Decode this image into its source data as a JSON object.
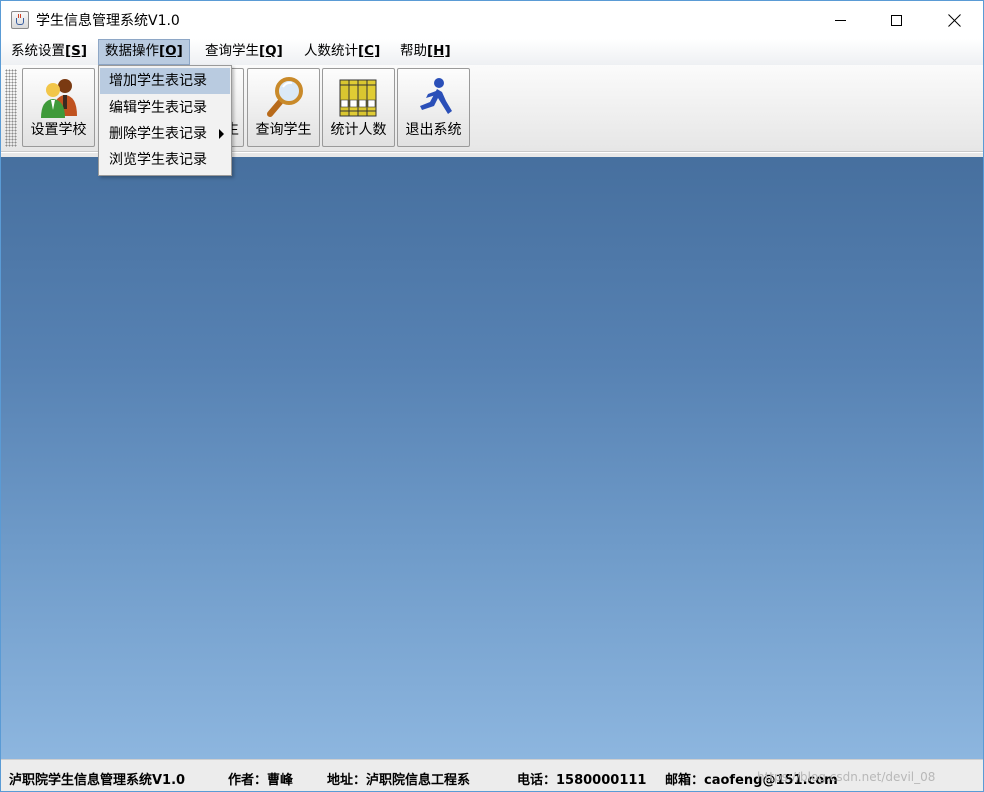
{
  "window": {
    "title": "学生信息管理系统V1.0"
  },
  "menubar": {
    "items": [
      {
        "label": "系统设置",
        "mnemonic": "[S]"
      },
      {
        "label": "数据操作",
        "mnemonic": "[O]"
      },
      {
        "label": "查询学生",
        "mnemonic": "[Q]"
      },
      {
        "label": "人数统计",
        "mnemonic": "[C]"
      },
      {
        "label": "帮助",
        "mnemonic": "[H]"
      }
    ]
  },
  "toolbar": {
    "buttons": [
      {
        "label": "设置学校",
        "icon": "users-icon"
      },
      {
        "label": "生",
        "icon": "hidden-icon"
      },
      {
        "label": "查询学生",
        "icon": "magnifier-icon"
      },
      {
        "label": "统计人数",
        "icon": "binders-icon"
      },
      {
        "label": "退出系统",
        "icon": "running-man-icon"
      }
    ]
  },
  "dropdown": {
    "items": [
      {
        "label": "增加学生表记录"
      },
      {
        "label": "编辑学生表记录"
      },
      {
        "label": "删除学生表记录"
      },
      {
        "label": "浏览学生表记录"
      }
    ]
  },
  "statusbar": {
    "app": "泸职院学生信息管理系统V1.0",
    "author": "作者：曹峰",
    "address": "地址：泸职院信息工程系",
    "phone": "电话：1580000111",
    "email": "邮箱：caofeng@151.com",
    "watermark": "https://blog.csdn.net/devil_08"
  },
  "colors": {
    "menu_highlight": "#b9cbe0",
    "desktop_top": "#466f9e",
    "desktop_bottom": "#8db6df"
  }
}
